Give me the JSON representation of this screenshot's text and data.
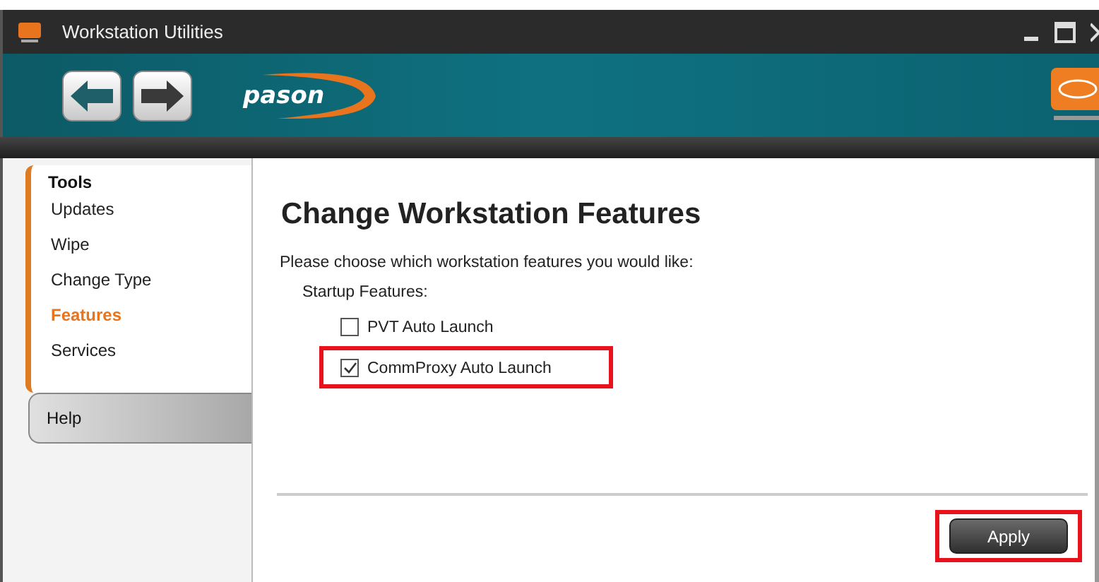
{
  "window": {
    "title": "Workstation Utilities"
  },
  "banner": {
    "logo": "pason"
  },
  "sidebar": {
    "section": "Tools",
    "items": [
      {
        "label": "Updates",
        "selected": false
      },
      {
        "label": "Wipe",
        "selected": false
      },
      {
        "label": "Change Type",
        "selected": false
      },
      {
        "label": "Features",
        "selected": true
      },
      {
        "label": "Services",
        "selected": false
      }
    ],
    "help_tab": "Help"
  },
  "main": {
    "heading": "Change Workstation Features",
    "intro": "Please choose which workstation features you would like:",
    "group_label": "Startup Features:",
    "options": [
      {
        "label": "PVT Auto Launch",
        "checked": false,
        "highlighted": false
      },
      {
        "label": "CommProxy Auto Launch",
        "checked": true,
        "highlighted": true
      }
    ],
    "apply": {
      "label": "Apply",
      "highlighted": true
    }
  }
}
